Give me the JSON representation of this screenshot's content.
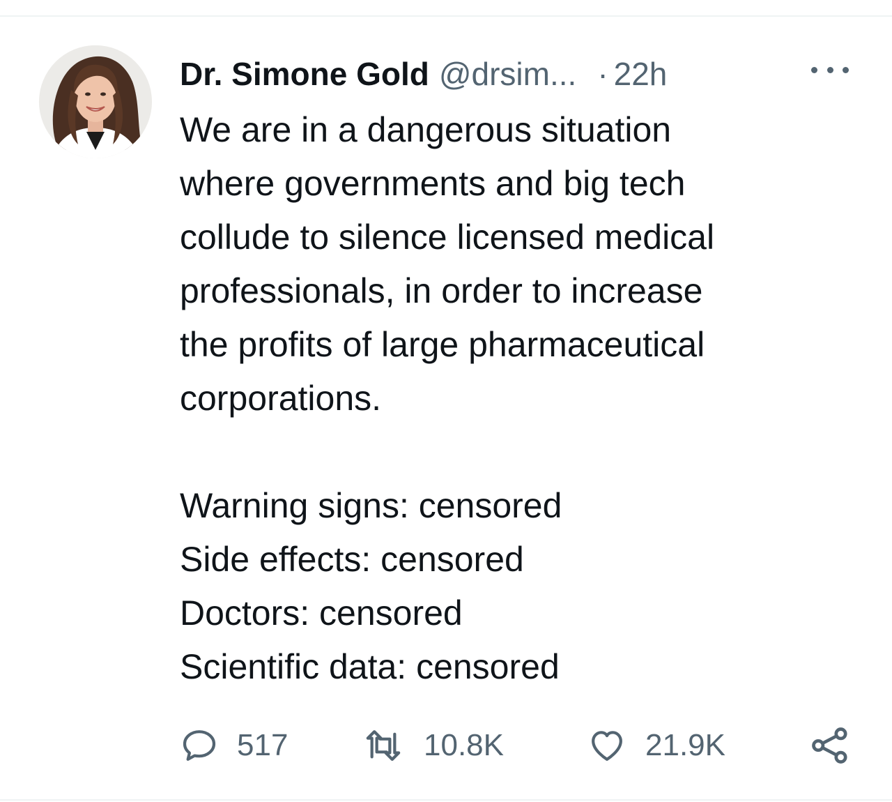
{
  "author": {
    "display_name": "Dr. Simone Gold",
    "handle": "@drsim...",
    "separator": "·",
    "time": "22h"
  },
  "tweet": {
    "paragraph_1": [
      "We are in a dangerous situation",
      "where governments and big tech",
      "collude to silence licensed medical",
      "professionals, in order to increase",
      "the profits of large pharmaceutical",
      "corporations."
    ],
    "paragraph_2": [
      "Warning signs: censored",
      "Side effects: censored",
      "Doctors: censored",
      "Scientific data: censored"
    ]
  },
  "actions": {
    "reply_count": "517",
    "retweet_count": "10.8K",
    "like_count": "21.9K"
  },
  "icons": {
    "more": "more-horizontal-icon",
    "reply": "reply-icon",
    "retweet": "retweet-icon",
    "like": "heart-icon",
    "share": "share-icon"
  },
  "colors": {
    "text_primary": "#0f1419",
    "text_secondary": "#536471",
    "divider": "#eff3f4"
  }
}
